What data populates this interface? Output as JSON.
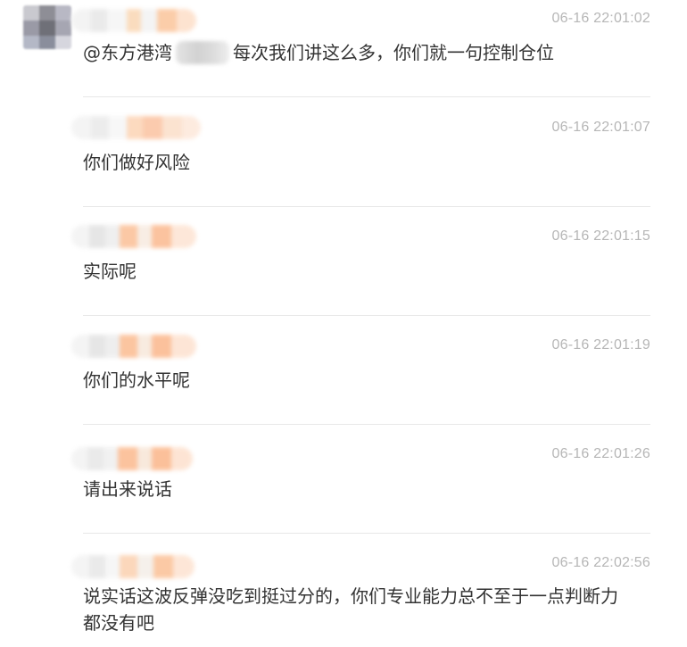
{
  "messages": [
    {
      "time": "06-16 22:01:02",
      "mention": "@东方港湾",
      "text": "每次我们讲这么多，你们就一句控制仓位"
    },
    {
      "time": "06-16 22:01:07",
      "text": "你们做好风险"
    },
    {
      "time": "06-16 22:01:15",
      "text": "实际呢"
    },
    {
      "time": "06-16 22:01:19",
      "text": "你们的水平呢"
    },
    {
      "time": "06-16 22:01:26",
      "text": "请出来说话"
    },
    {
      "time": "06-16 22:02:56",
      "text": "说实话这波反弹没吃到挺过分的，你们专业能力总不至于一点判断力都没有吧"
    }
  ]
}
